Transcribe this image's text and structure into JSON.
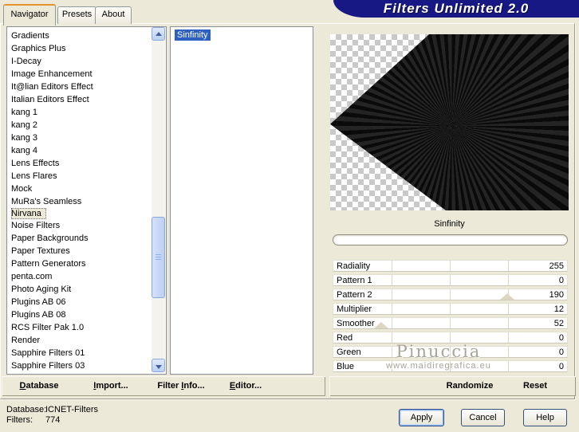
{
  "window": {
    "title": "Filters Unlimited 2.0"
  },
  "tabs": [
    {
      "label": "Navigator",
      "active": true
    },
    {
      "label": "Presets",
      "active": false
    },
    {
      "label": "About",
      "active": false
    }
  ],
  "category_list": {
    "selected": "Nirvana",
    "items": [
      "Gradients",
      "Graphics Plus",
      "I-Decay",
      "Image Enhancement",
      "It@lian Editors Effect",
      "Italian Editors Effect",
      "kang 1",
      "kang 2",
      "kang 3",
      "kang 4",
      "Lens Effects",
      "Lens Flares",
      "Mock",
      "MuRa's Seamless",
      "Nirvana",
      "Noise Filters",
      "Paper Backgrounds",
      "Paper Textures",
      "Pattern Generators",
      "penta.com",
      "Photo Aging Kit",
      "Plugins AB 06",
      "Plugins AB 08",
      "RCS Filter Pak 1.0",
      "Render",
      "Sapphire Filters 01",
      "Sapphire Filters 03"
    ]
  },
  "filter_list": {
    "selected": "Sinfinity",
    "items": [
      "Sinfinity"
    ]
  },
  "preview": {
    "caption": "Sinfinity",
    "progress_percent": 0
  },
  "sliders": [
    {
      "label": "Radiality",
      "value": "255"
    },
    {
      "label": "Pattern 1",
      "value": "0"
    },
    {
      "label": "Pattern 2",
      "value": "190",
      "marker_left": "74.5%"
    },
    {
      "label": "Multiplier",
      "value": "12"
    },
    {
      "label": "Smoother",
      "value": "52",
      "marker_left": "20.4%"
    },
    {
      "label": "Red",
      "value": "0"
    },
    {
      "label": "Green",
      "value": "0"
    },
    {
      "label": "Blue",
      "value": "0"
    }
  ],
  "watermark": {
    "line1": "Pinuccia",
    "line2": "www.maidiregrafica.eu"
  },
  "toolbar": {
    "database": {
      "pre": "",
      "key": "D",
      "post": "atabase"
    },
    "import": {
      "pre": "",
      "key": "I",
      "post": "mport..."
    },
    "filter_info": {
      "pre": "Filter ",
      "key": "I",
      "post": "nfo..."
    },
    "editor": {
      "pre": "",
      "key": "E",
      "post": "ditor..."
    },
    "randomize": "Randomize",
    "reset": "Reset"
  },
  "status": {
    "database_label": "Database:",
    "database_value": "ICNET-Filters",
    "filters_label": "Filters:",
    "filters_value": "774"
  },
  "action_buttons": {
    "apply": "Apply",
    "cancel": "Cancel",
    "help": "Help"
  },
  "colors": {
    "banner": "#181885",
    "selection_blue": "#2e5fc2",
    "tab_accent_orange": "#e6922c",
    "dialog_bg": "#ece9d8"
  }
}
